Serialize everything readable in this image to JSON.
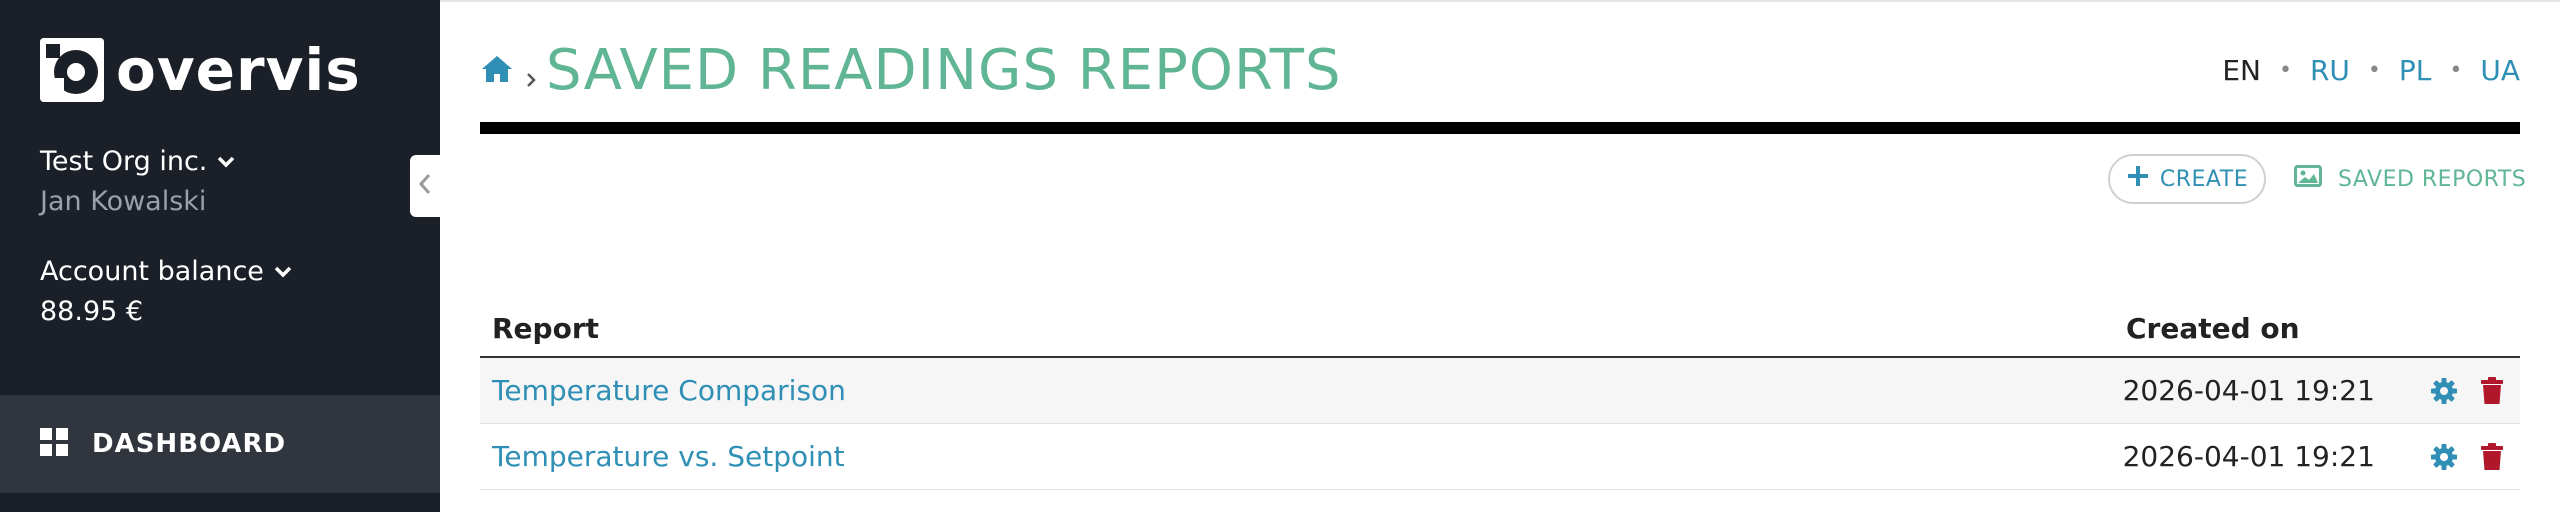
{
  "app": {
    "logo_text": "overvis"
  },
  "sidebar": {
    "org_name": "Test Org inc.",
    "user_name": "Jan Kowalski",
    "balance_label": "Account balance",
    "balance_value": "88.95 €",
    "nav": [
      {
        "label": "DASHBOARD",
        "icon": "grid-icon"
      }
    ]
  },
  "header": {
    "title": "SAVED READINGS REPORTS",
    "breadcrumb_icon": "home-icon",
    "languages": [
      "EN",
      "RU",
      "PL",
      "UA"
    ],
    "active_language": "EN"
  },
  "toolbar": {
    "create_label": "CREATE",
    "saved_reports_label": "SAVED REPORTS"
  },
  "table": {
    "columns": [
      "Report",
      "Created on"
    ],
    "rows": [
      {
        "report": "Temperature Comparison",
        "created_on": "2026-04-01 19:21"
      },
      {
        "report": "Temperature vs. Setpoint",
        "created_on": "2026-04-01 19:21"
      }
    ]
  },
  "colors": {
    "sidebar_bg": "#1b1f27",
    "nav_active_bg": "#30353e",
    "title": "#5fb594",
    "link": "#2f8fb5",
    "delete": "#b0172a"
  }
}
